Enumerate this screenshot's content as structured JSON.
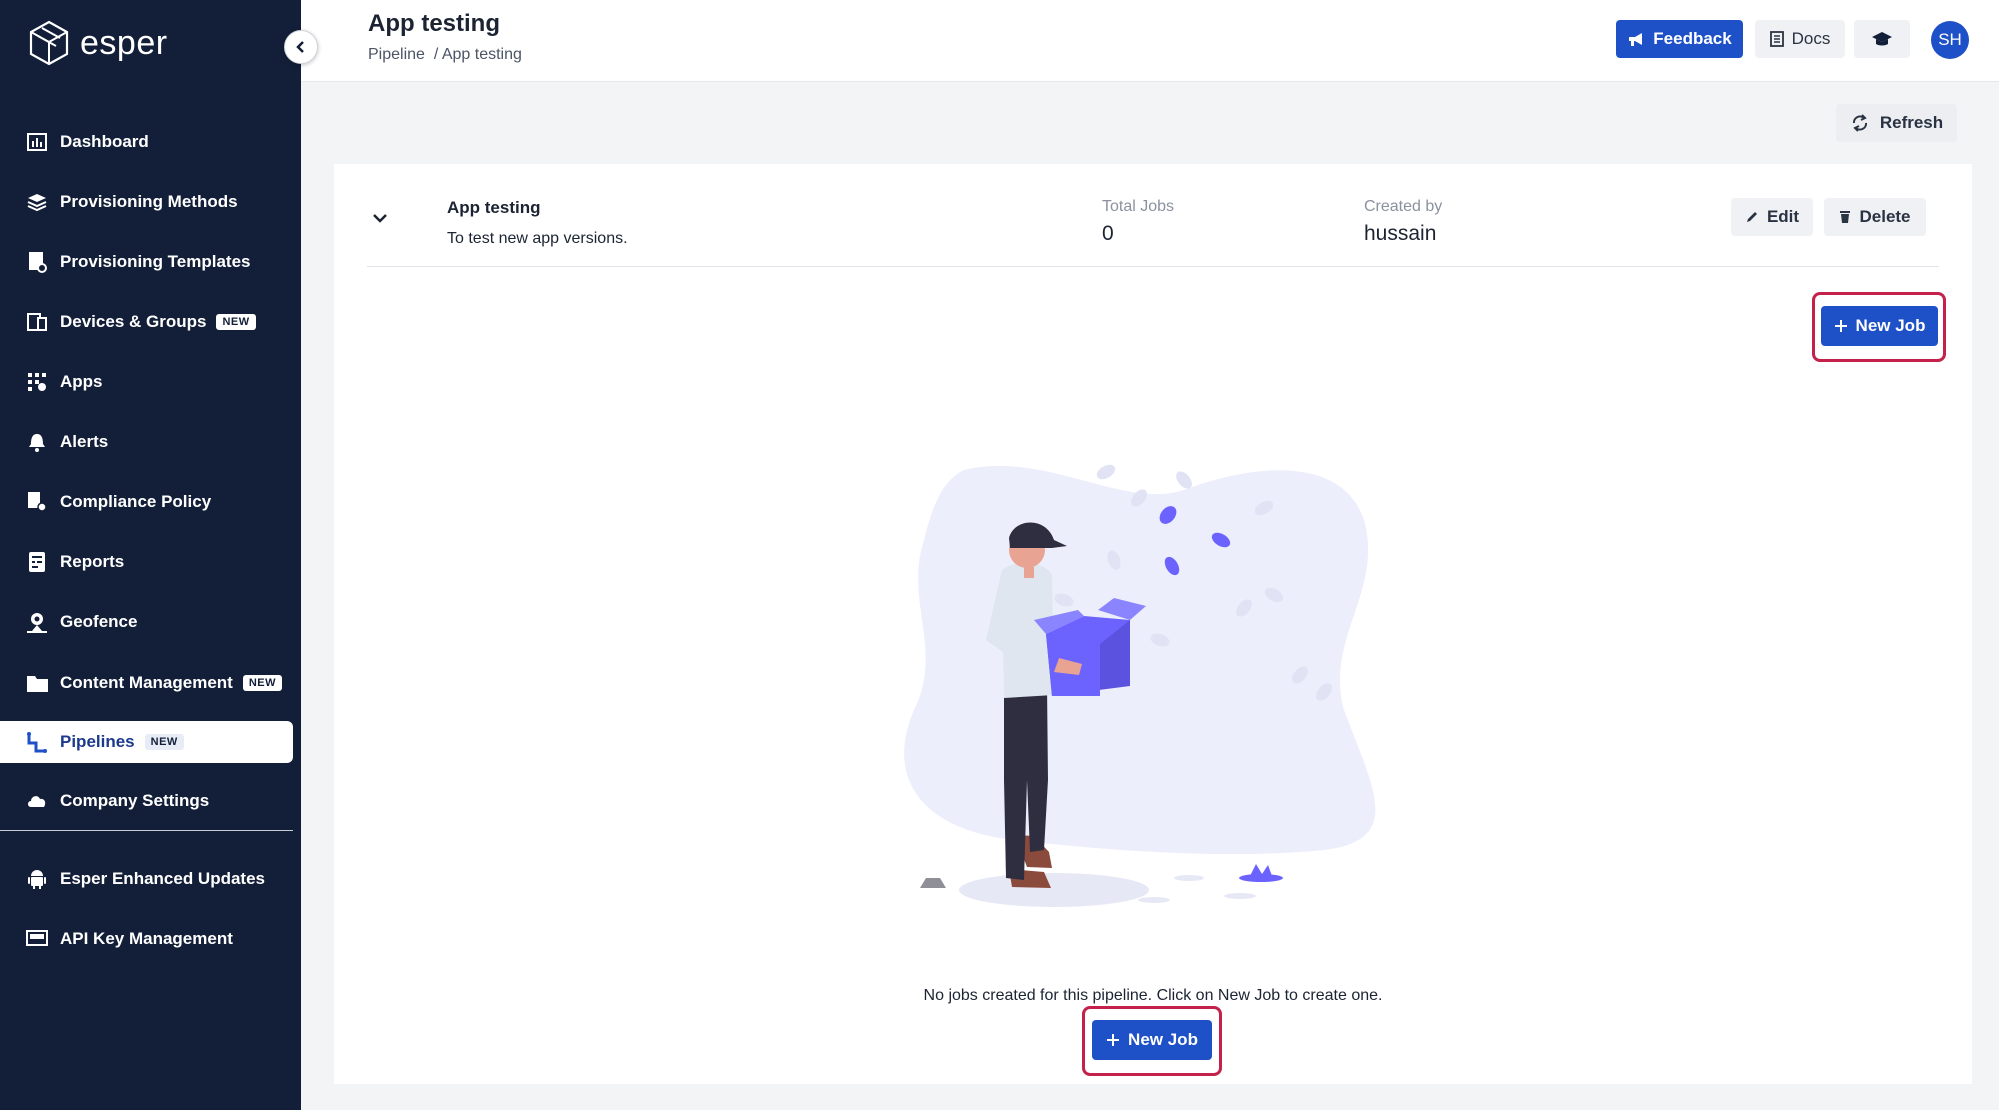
{
  "brand": {
    "name": "esper"
  },
  "sidebar": {
    "items": [
      {
        "label": "Dashboard",
        "icon": "dashboard-icon"
      },
      {
        "label": "Provisioning Methods",
        "icon": "layers-icon"
      },
      {
        "label": "Provisioning Templates",
        "icon": "template-icon"
      },
      {
        "label": "Devices & Groups",
        "icon": "devices-icon",
        "badge": "NEW"
      },
      {
        "label": "Apps",
        "icon": "apps-icon"
      },
      {
        "label": "Alerts",
        "icon": "bell-icon"
      },
      {
        "label": "Compliance Policy",
        "icon": "policy-icon"
      },
      {
        "label": "Reports",
        "icon": "reports-icon"
      },
      {
        "label": "Geofence",
        "icon": "geofence-icon"
      },
      {
        "label": "Content Management",
        "icon": "folder-icon",
        "badge": "NEW"
      },
      {
        "label": "Pipelines",
        "icon": "pipeline-icon",
        "badge": "NEW",
        "active": true
      },
      {
        "label": "Company Settings",
        "icon": "cloud-icon"
      },
      {
        "label": "Esper Enhanced Updates",
        "icon": "android-icon"
      },
      {
        "label": "API Key Management",
        "icon": "key-management-icon"
      }
    ]
  },
  "header": {
    "title": "App testing",
    "breadcrumb": [
      "Pipeline",
      "/ App testing"
    ],
    "feedback_label": "Feedback",
    "docs_label": "Docs",
    "avatar_initials": "SH"
  },
  "toolbar": {
    "refresh_label": "Refresh"
  },
  "pipeline": {
    "name": "App testing",
    "description": "To test new app versions.",
    "total_jobs_label": "Total Jobs",
    "total_jobs_value": "0",
    "created_by_label": "Created by",
    "created_by_value": "hussain",
    "edit_label": "Edit",
    "delete_label": "Delete"
  },
  "jobs": {
    "new_job_label": "New Job",
    "empty_message": "No jobs created for this pipeline. Click on New Job to create one."
  },
  "colors": {
    "sidebar_bg": "#131f38",
    "primary": "#1e50c8",
    "highlight": "#c4224a",
    "illustration_accent": "#6c63ff"
  }
}
